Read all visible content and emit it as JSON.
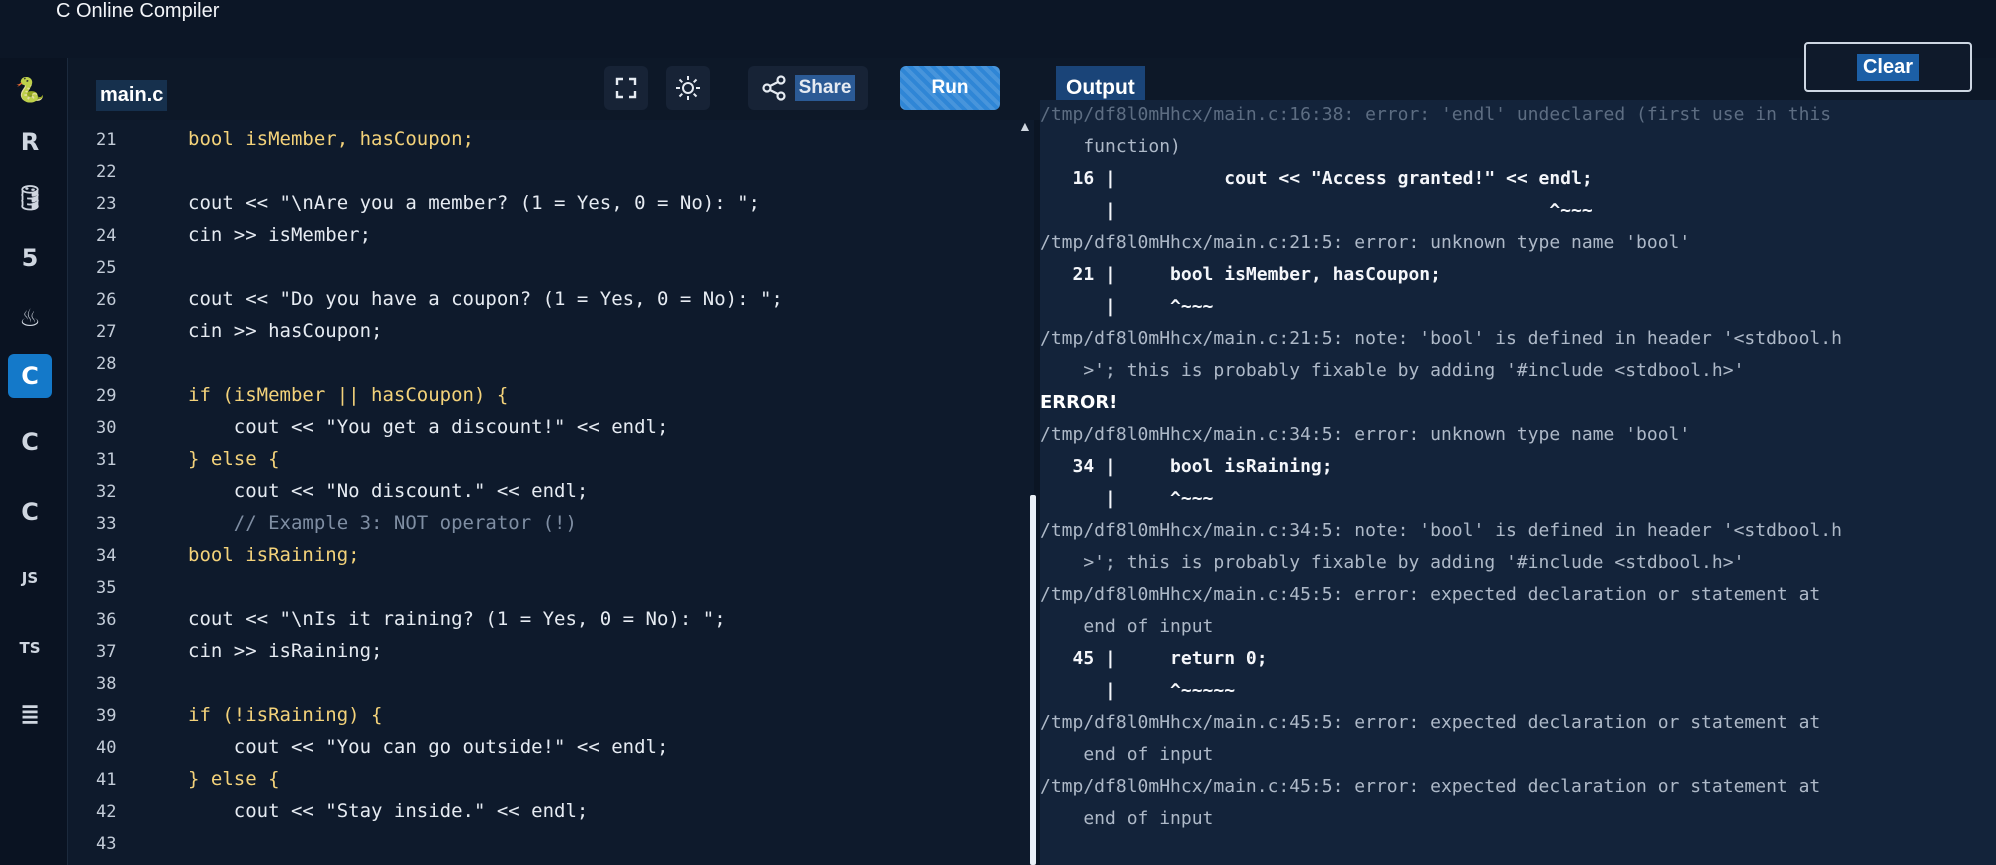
{
  "app": {
    "title": "C Online Compiler"
  },
  "sidebar": {
    "items": [
      {
        "name": "python",
        "glyph": "🐍"
      },
      {
        "name": "r",
        "glyph": "R"
      },
      {
        "name": "sql",
        "glyph": "🛢"
      },
      {
        "name": "html5",
        "glyph": "5"
      },
      {
        "name": "java",
        "glyph": "♨"
      },
      {
        "name": "c",
        "glyph": "C"
      },
      {
        "name": "cpp",
        "glyph": "C"
      },
      {
        "name": "csharp",
        "glyph": "C"
      },
      {
        "name": "js",
        "glyph": "JS"
      },
      {
        "name": "ts",
        "glyph": "TS"
      },
      {
        "name": "db",
        "glyph": "≣"
      }
    ]
  },
  "toolbar": {
    "file_tab": "main.c",
    "share_label": "Share",
    "run_label": "Run",
    "output_label": "Output",
    "clear_label": "Clear"
  },
  "editor": {
    "line_numbers": [
      "21",
      "22",
      "23",
      "24",
      "25",
      "26",
      "27",
      "28",
      "29",
      "30",
      "31",
      "32",
      "33",
      "34",
      "35",
      "36",
      "37",
      "38",
      "39",
      "40",
      "41",
      "42",
      "43"
    ],
    "lines": [
      "bool isMember, hasCoupon;",
      "",
      "cout << \"\\nAre you a member? (1 = Yes, 0 = No): \";",
      "cin >> isMember;",
      "",
      "cout << \"Do you have a coupon? (1 = Yes, 0 = No): \";",
      "cin >> hasCoupon;",
      "",
      "if (isMember || hasCoupon) {",
      "    cout << \"You get a discount!\" << endl;",
      "} else {",
      "    cout << \"No discount.\" << endl;",
      "    // Example 3: NOT operator (!)",
      "bool isRaining;",
      "",
      "cout << \"\\nIs it raining? (1 = Yes, 0 = No): \";",
      "cin >> isRaining;",
      "",
      "if (!isRaining) {",
      "    cout << \"You can go outside!\" << endl;",
      "} else {",
      "    cout << \"Stay inside.\" << endl;",
      ""
    ]
  },
  "output": {
    "lines": [
      "/tmp/df8l0mHhcx/main.c:16:38: error: 'endl' undeclared (first use in this",
      "    function)",
      "   16 |          cout << \"Access granted!\" << endl;",
      "      |                                        ^~~~",
      "/tmp/df8l0mHhcx/main.c:21:5: error: unknown type name 'bool'",
      "   21 |     bool isMember, hasCoupon;",
      "      |     ^~~~",
      "/tmp/df8l0mHhcx/main.c:21:5: note: 'bool' is defined in header '<stdbool.h",
      "    >'; this is probably fixable by adding '#include <stdbool.h>'",
      "ERROR!",
      "/tmp/df8l0mHhcx/main.c:34:5: error: unknown type name 'bool'",
      "   34 |     bool isRaining;",
      "      |     ^~~~",
      "/tmp/df8l0mHhcx/main.c:34:5: note: 'bool' is defined in header '<stdbool.h",
      "    >'; this is probably fixable by adding '#include <stdbool.h>'",
      "/tmp/df8l0mHhcx/main.c:45:5: error: expected declaration or statement at",
      "    end of input",
      "   45 |     return 0;",
      "      |     ^~~~~~",
      "/tmp/df8l0mHhcx/main.c:45:5: error: expected declaration or statement at",
      "    end of input",
      "/tmp/df8l0mHhcx/main.c:45:5: error: expected declaration or statement at",
      "    end of input"
    ]
  },
  "colors": {
    "accent": "#2f86d6",
    "active_language": "#1479c9",
    "keyword": "#f3c35a",
    "background": "#0b1524"
  }
}
